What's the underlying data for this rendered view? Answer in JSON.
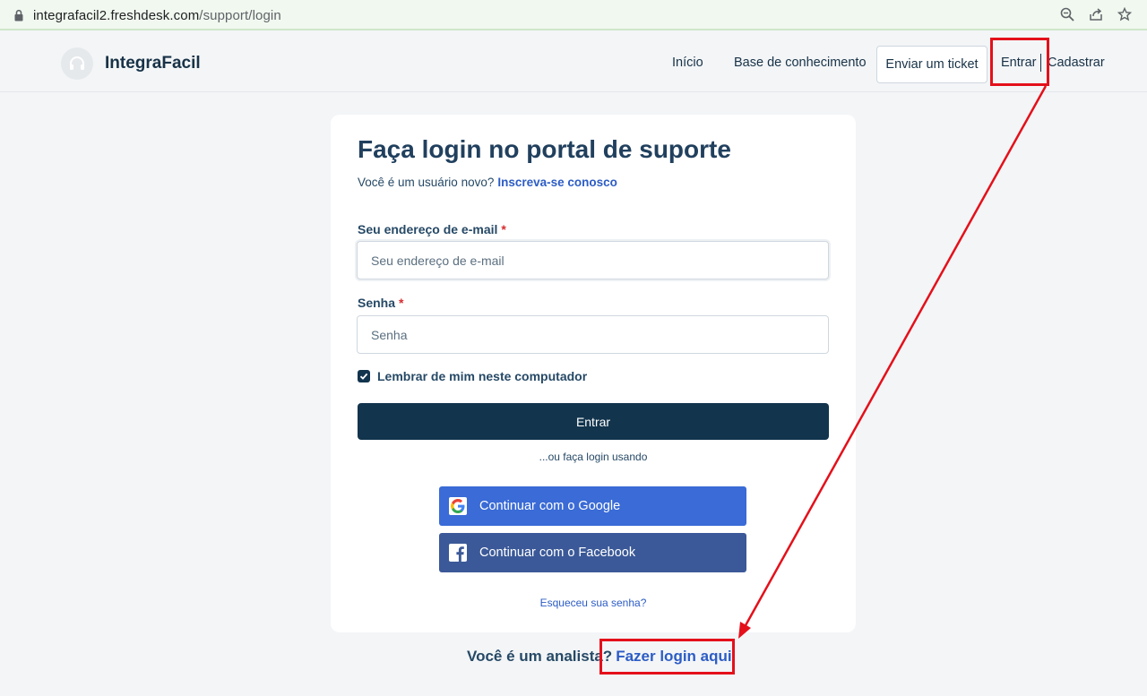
{
  "browser": {
    "url_host": "integrafacil2.freshdesk.com",
    "url_path": "/support/login",
    "icons": [
      "lock-icon",
      "zoom-icon",
      "share-icon",
      "star-icon"
    ]
  },
  "header": {
    "brand": "IntegraFacil",
    "nav": {
      "inicio": "Início",
      "base": "Base de conhecimento",
      "ticket": "Enviar um ticket",
      "entrar": "Entrar",
      "cadastrar": "Cadastrar"
    }
  },
  "login": {
    "title": "Faça login no portal de suporte",
    "subtitle": "Você é um usuário novo?",
    "signup_link": "Inscreva-se conosco",
    "email_label": "Seu endereço de e-mail",
    "email_placeholder": "Seu endereço de e-mail",
    "password_label": "Senha",
    "password_placeholder": "Senha",
    "required_mark": "*",
    "remember_label": "Lembrar de mim neste computador",
    "remember_checked": true,
    "submit_label": "Entrar",
    "or_text": "...ou faça login usando",
    "google_label": "Continuar com o Google",
    "facebook_label": "Continuar com o Facebook",
    "forgot_label": "Esqueceu sua senha?"
  },
  "agent": {
    "prompt": "Você é um analista?",
    "link": "Fazer login aqui"
  },
  "colors": {
    "primary": "#12344d",
    "link": "#2c5cc5",
    "google": "#3a6bd6",
    "facebook": "#3b5998",
    "annotation": "#e4101a"
  }
}
